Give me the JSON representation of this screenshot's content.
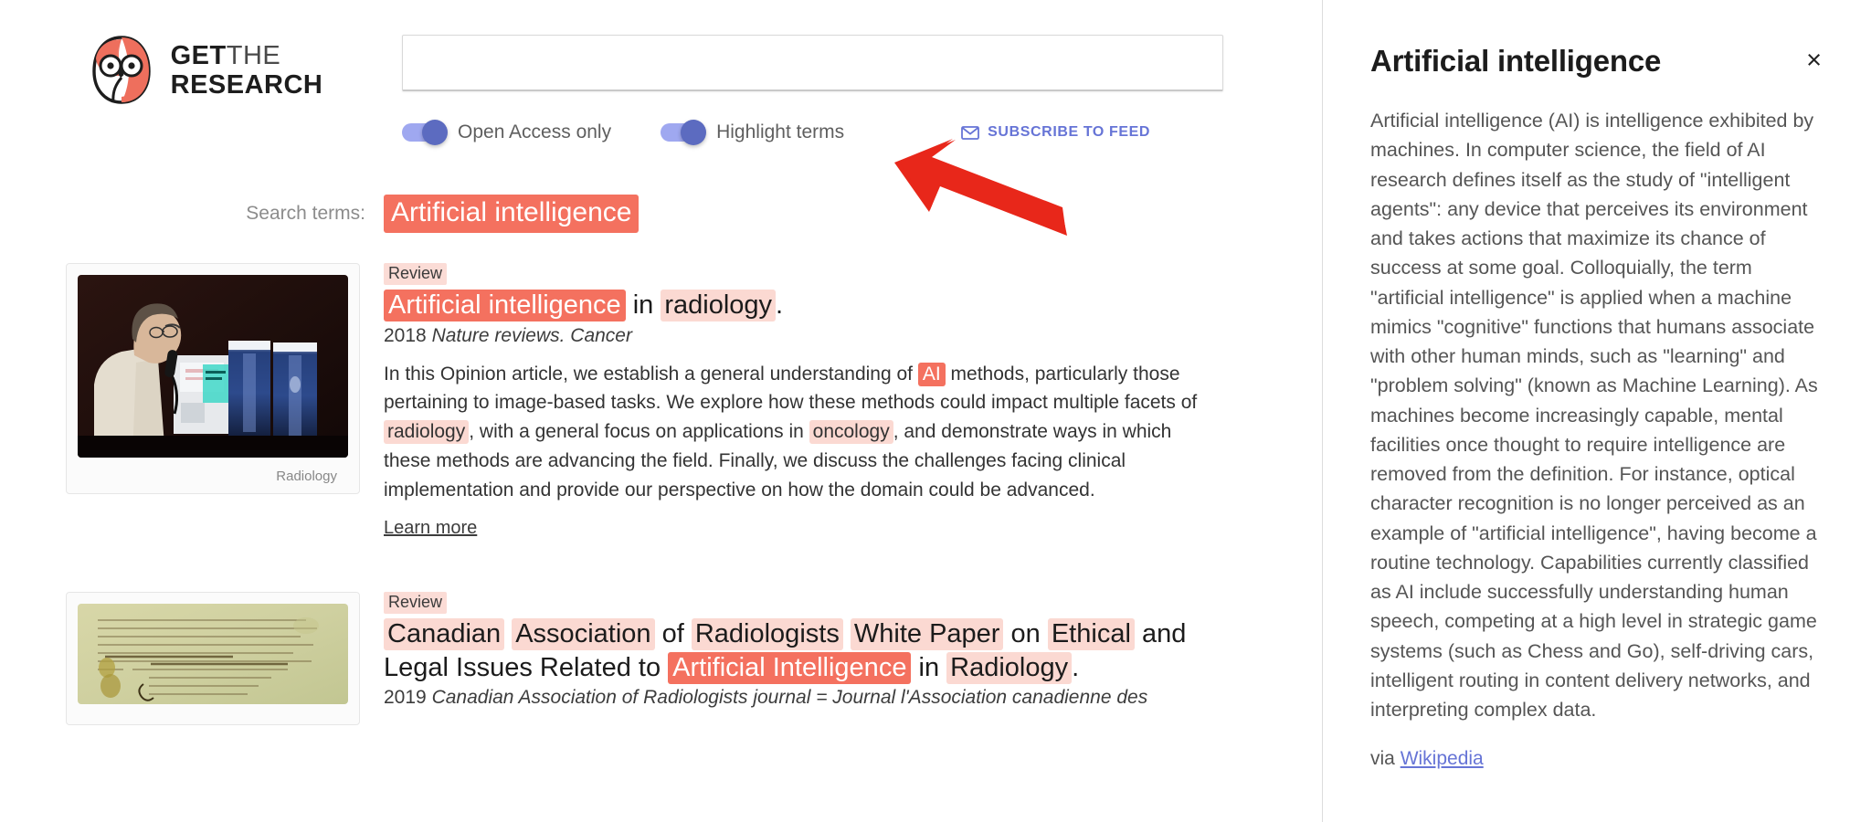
{
  "brand": {
    "line1_bold": "GET",
    "line1_light": "THE",
    "line2": "RESEARCH",
    "logo_icon": "owl-logo-icon",
    "accent_color": "#f4715f"
  },
  "search": {
    "value": "",
    "placeholder": ""
  },
  "controls": {
    "open_access": {
      "label": "Open Access only",
      "on": true
    },
    "highlight_terms": {
      "label": "Highlight terms",
      "on": true
    },
    "subscribe": {
      "label": "SUBSCRIBE TO FEED",
      "icon": "envelope-icon"
    },
    "toggle_on_color": "#5c6bc0",
    "toggle_track_color": "#9fa8f0"
  },
  "search_terms": {
    "label": "Search terms:",
    "terms": [
      "Artificial intelligence"
    ]
  },
  "results": [
    {
      "badge": "Review",
      "title_parts": [
        {
          "text": "Artificial intelligence",
          "hl": "strong"
        },
        {
          "text": " in ",
          "hl": "none"
        },
        {
          "text": "radiology",
          "hl": "soft"
        },
        {
          "text": ".",
          "hl": "none"
        }
      ],
      "year": "2018",
      "journal": "Nature reviews. Cancer",
      "abstract_parts": [
        {
          "text": "In this Opinion article, we establish a general understanding of ",
          "hl": "none"
        },
        {
          "text": "AI",
          "hl": "strong"
        },
        {
          "text": " methods, particularly those pertaining to image-based tasks. We explore how these methods could impact multiple facets of ",
          "hl": "none"
        },
        {
          "text": "radiology",
          "hl": "soft"
        },
        {
          "text": ", with a general focus on applications in ",
          "hl": "none"
        },
        {
          "text": "oncology",
          "hl": "soft"
        },
        {
          "text": ", and demonstrate ways in which these methods are advancing the field. Finally, we discuss the challenges facing clinical implementation and provide our perspective on how the domain could be advanced.",
          "hl": "none"
        }
      ],
      "learn_more": "Learn more",
      "thumb": {
        "caption": "Radiology",
        "alt": "radiologist-at-workstation-image"
      }
    },
    {
      "badge": "Review",
      "title_parts": [
        {
          "text": "Canadian",
          "hl": "soft"
        },
        {
          "text": " ",
          "hl": "none"
        },
        {
          "text": "Association",
          "hl": "soft"
        },
        {
          "text": " of ",
          "hl": "none"
        },
        {
          "text": "Radiologists",
          "hl": "soft"
        },
        {
          "text": " ",
          "hl": "none"
        },
        {
          "text": "White Paper",
          "hl": "soft"
        },
        {
          "text": " on ",
          "hl": "none"
        },
        {
          "text": "Ethical",
          "hl": "soft"
        },
        {
          "text": " and Legal Issues Related to ",
          "hl": "none"
        },
        {
          "text": "Artificial Intelligence",
          "hl": "strong"
        },
        {
          "text": " in ",
          "hl": "none"
        },
        {
          "text": "Radiology",
          "hl": "soft"
        },
        {
          "text": ".",
          "hl": "none"
        }
      ],
      "year": "2019",
      "journal": "Canadian Association of Radiologists journal = Journal l'Association canadienne des",
      "abstract_parts": [],
      "learn_more": "",
      "thumb": {
        "caption": "",
        "alt": "old-manuscript-parchment-image"
      }
    }
  ],
  "sidebar": {
    "title": "Artificial intelligence",
    "close_icon": "close-icon",
    "body": "Artificial intelligence (AI) is intelligence exhibited by machines. In computer science, the field of AI research defines itself as the study of \"intelligent agents\": any device that perceives its environment and takes actions that maximize its chance of success at some goal. Colloquially, the term \"artificial intelligence\" is applied when a machine mimics \"cognitive\" functions that humans associate with other human minds, such as \"learning\" and \"problem solving\" (known as Machine Learning). As machines become increasingly capable, mental facilities once thought to require intelligence are removed from the definition. For instance, optical character recognition is no longer perceived as an example of \"artificial intelligence\", having become a routine technology. Capabilities currently classified as AI include successfully understanding human speech, competing at a high level in strategic game systems (such as Chess and Go), self-driving cars, intelligent routing in content delivery networks, and interpreting complex data.",
    "via_prefix": "via ",
    "via_link": "Wikipedia"
  },
  "annotation": {
    "arrow": {
      "color": "#e8271a",
      "points_to": "highlight-terms-toggle"
    }
  }
}
